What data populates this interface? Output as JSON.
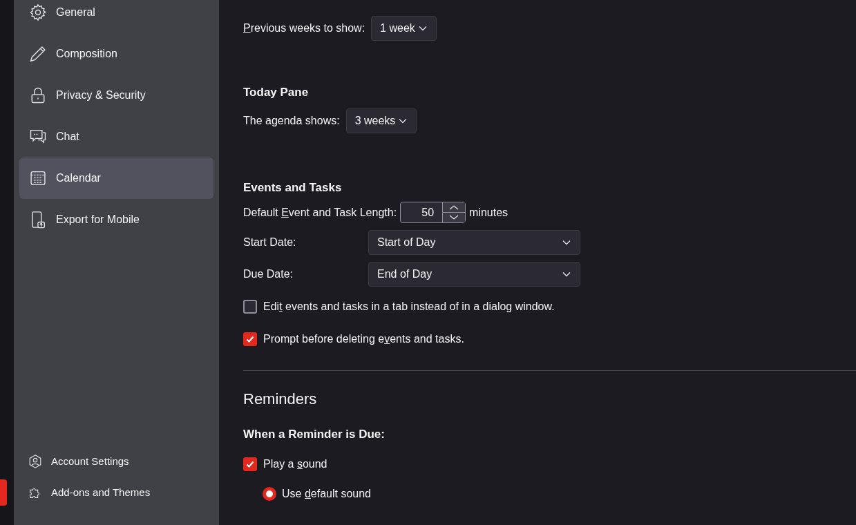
{
  "sidebar": {
    "items": [
      {
        "label": "General",
        "selected": false
      },
      {
        "label": "Composition",
        "selected": false
      },
      {
        "label": "Privacy & Security",
        "selected": false
      },
      {
        "label": "Chat",
        "selected": false
      },
      {
        "label": "Calendar",
        "selected": true
      },
      {
        "label": "Export for Mobile",
        "selected": false
      }
    ],
    "footer": [
      {
        "label": "Account Settings"
      },
      {
        "label": "Add-ons and Themes"
      }
    ]
  },
  "previous_weeks": {
    "label": {
      "key": "P",
      "post": "revious weeks to show:"
    },
    "value": "1 week"
  },
  "today_pane": {
    "heading": "Today Pane",
    "label": "The agenda shows:",
    "value": "3 weeks"
  },
  "events_tasks": {
    "heading": "Events and Tasks",
    "length": {
      "label": {
        "pre": "Default ",
        "key": "E",
        "post": "vent and Task Length:"
      },
      "value": "50",
      "unit": "minutes"
    },
    "selects": [
      {
        "label": "Start Date:",
        "value": "Start of Day"
      },
      {
        "label": "Due Date:",
        "value": "End of Day"
      }
    ],
    "checkboxes": [
      {
        "label": {
          "pre": "Edi",
          "key": "t",
          "post": " events and tasks in a tab instead of in a dialog window."
        },
        "checked": false
      },
      {
        "label": {
          "pre": "Prompt before deleting e",
          "key": "v",
          "post": "ents and tasks."
        },
        "checked": true
      }
    ]
  },
  "reminders": {
    "heading": "Reminders",
    "subheading": "When a Reminder is Due:",
    "play_sound": {
      "label": {
        "pre": "Play a ",
        "key": "s",
        "post": "ound"
      },
      "checked": true
    },
    "radios": [
      {
        "label": {
          "pre": "Use ",
          "key": "d",
          "post": "efault sound"
        },
        "selected": true
      }
    ]
  }
}
